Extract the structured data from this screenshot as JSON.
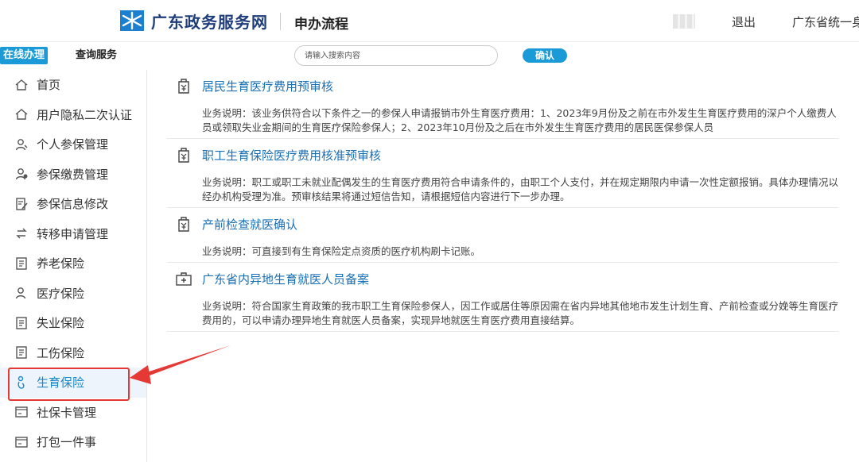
{
  "header": {
    "logo_text": "广东政务服务网",
    "subtitle": "申办流程",
    "logout": "退出",
    "user": "广东省统一身"
  },
  "nav": {
    "tabs": [
      {
        "label": "在线办理",
        "active": true
      },
      {
        "label": "查询服务",
        "active": false
      }
    ],
    "search_placeholder": "请输入搜索内容",
    "confirm_label": "确认"
  },
  "sidebar": {
    "items": [
      {
        "label": "首页",
        "icon": "home-icon"
      },
      {
        "label": "用户隐私二次认证",
        "icon": "home-icon"
      },
      {
        "label": "个人参保管理",
        "icon": "person-icon"
      },
      {
        "label": "参保缴费管理",
        "icon": "person-money-icon"
      },
      {
        "label": "参保信息修改",
        "icon": "edit-document-icon"
      },
      {
        "label": "转移申请管理",
        "icon": "transfer-icon"
      },
      {
        "label": "养老保险",
        "icon": "document-icon"
      },
      {
        "label": "医疗保险",
        "icon": "person-icon"
      },
      {
        "label": "失业保险",
        "icon": "document-icon"
      },
      {
        "label": "工伤保险",
        "icon": "document-icon"
      },
      {
        "label": "生育保险",
        "icon": "maternity-icon",
        "active": true
      },
      {
        "label": "社保卡管理",
        "icon": "card-icon"
      },
      {
        "label": "打包一件事",
        "icon": "card-icon"
      }
    ],
    "accent_color": "#1a88c9"
  },
  "services": [
    {
      "title": "居民生育医疗费用预审核",
      "icon": "yuan-bag-icon",
      "desc": "业务说明：该业务供符合以下条件之一的参保人申请报销市外生育医疗费用：1、2023年9月份及之前在市外发生生育医疗费用的深户个人缴费人员或领取失业金期间的生育医疗保险参保人；2、2023年10月份及之后在市外发生生育医疗费用的居民医保参保人员"
    },
    {
      "title": "职工生育保险医疗费用核准预审核",
      "icon": "yuan-bag-icon",
      "desc": "业务说明：职工或职工未就业配偶发生的生育医疗费用符合申请条件的，由职工个人支付，并在规定期限内申请一次性定额报销。具体办理情况以经办机构受理为准。预审核结果将通过短信告知，请根据短信内容进行下一步办理。"
    },
    {
      "title": "产前检查就医确认",
      "icon": "yuan-bag-icon",
      "desc": "业务说明：可直接到有生育保险定点资质的医疗机构刷卡记账。"
    },
    {
      "title": "广东省内异地生育就医人员备案",
      "icon": "medical-kit-icon",
      "desc": "业务说明：符合国家生育政策的我市职工生育保险参保人，因工作或居住等原因需在省内异地其他地市发生计划生育、产前检查或分娩等生育医疗费用的，可以申请办理异地生育就医人员备案，实现异地就医生育医疗费用直接结算。"
    }
  ]
}
